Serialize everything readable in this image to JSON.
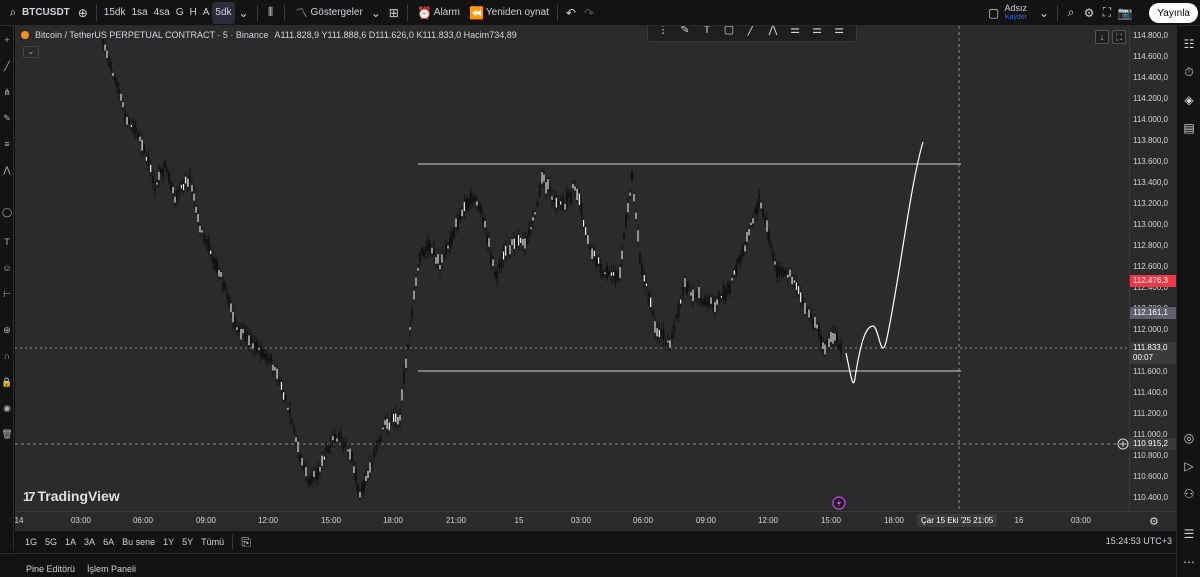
{
  "topbar": {
    "symbol": "BTCUSDT",
    "intervals": [
      "15dk",
      "1sa",
      "4sa",
      "G",
      "H",
      "A",
      "5dk"
    ],
    "indicators_label": "Göstergeler",
    "alarm_label": "Alarm",
    "replay_label": "Yeniden oynat",
    "user_name": "Adsız",
    "user_save": "Kaydet",
    "publish_label": "Yayınla"
  },
  "legend": {
    "title": "Bitcoin / TetherUS PERPETUAL CONTRACT · 5 · Binance",
    "open_label": "A",
    "open": "111.828,9",
    "high_label": "Y",
    "high": "111.888,6",
    "low_label": "D",
    "low": "111.626,0",
    "close_label": "K",
    "close": "111.833,0",
    "volume_label": "Hacim",
    "volume": "734,89"
  },
  "logo": "TradingView",
  "price_axis": {
    "labels": [
      "114.800,0",
      "114.600,0",
      "114.400,0",
      "114.200,0",
      "114.000,0",
      "113.800,0",
      "113.600,0",
      "113.400,0",
      "113.200,0",
      "113.000,0",
      "112.800,0",
      "112.600,0",
      "112.400,0",
      "112.200,0",
      "112.000,0",
      "111.600,0",
      "111.400,0",
      "111.200,0",
      "111.000,0",
      "110.800,0",
      "110.600,0",
      "110.400,0"
    ],
    "tag_red": "112.476,3",
    "tag_gray": "112.161,1",
    "tag_current": "111.833,0",
    "tag_countdown": "00:07",
    "tag_cross": "110.915,2"
  },
  "time_axis": {
    "labels": [
      "14",
      "03:00",
      "06:00",
      "09:00",
      "12:00",
      "15:00",
      "18:00",
      "21:00",
      "15",
      "03:00",
      "06:00",
      "09:00",
      "12:00",
      "15:00",
      "18:00",
      "16",
      "03:00"
    ],
    "cursor_date": "Çar 15 Eki '25",
    "cursor_time": "21:05"
  },
  "bottombar": {
    "ranges": [
      "1G",
      "5G",
      "1A",
      "3A",
      "6A",
      "Bu sene",
      "1Y",
      "5Y",
      "Tümü"
    ],
    "clock": "15:24:53 UTC+3"
  },
  "footer": {
    "pine_editor": "Pine Editörü",
    "trade_panel": "İşlem Paneli"
  },
  "colors": {
    "background": "#2b2b2b",
    "candle": "#000000",
    "tag_red": "#f23645",
    "tag_gray": "#5d606b",
    "accent": "#2962ff"
  }
}
